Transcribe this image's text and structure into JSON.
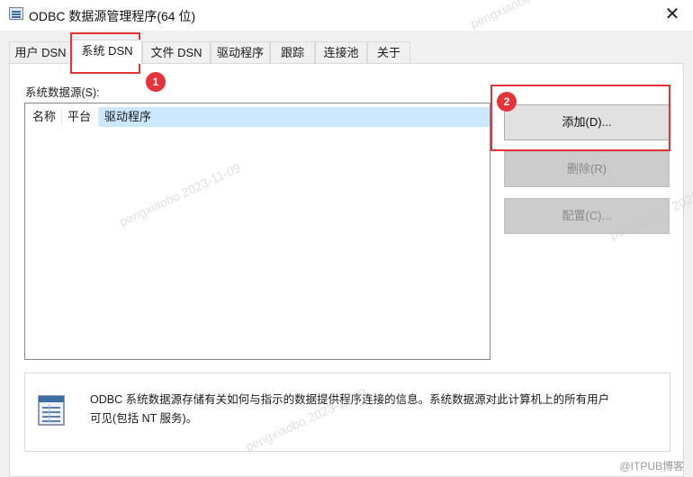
{
  "window": {
    "title": "ODBC 数据源管理程序(64 位)",
    "close_glyph": "✕"
  },
  "tabs": [
    {
      "label": "用户 DSN"
    },
    {
      "label": "系统 DSN"
    },
    {
      "label": "文件 DSN"
    },
    {
      "label": "驱动程序"
    },
    {
      "label": "跟踪"
    },
    {
      "label": "连接池"
    },
    {
      "label": "关于"
    }
  ],
  "active_tab": "系统 DSN",
  "system_dsn": {
    "section_label": "系统数据源(S):",
    "columns": [
      "名称",
      "平台",
      "驱动程序"
    ],
    "rows": []
  },
  "buttons": {
    "add": {
      "label": "添加(D)...",
      "enabled": true
    },
    "remove": {
      "label": "删除(R)",
      "enabled": false
    },
    "configure": {
      "label": "配置(C)...",
      "enabled": false
    }
  },
  "info": {
    "icon": "odbc-datasource-icon",
    "text_line1": "ODBC 系统数据源存储有关如何与指示的数据提供程序连接的信息。系统数据源对此计算机上的所有用户",
    "text_line2": "可见(包括 NT 服务)。"
  },
  "annotations": {
    "markers": [
      "1",
      "2"
    ],
    "color": "#e5333a"
  },
  "watermarks": [
    "pengxiaobo 2023-11-09",
    "pengxiaobo 2023-11-09",
    "pengxiaobo 2023-11-09",
    "pengxiaobo 2023-11-09"
  ],
  "credit": "@ITPUB博客"
}
